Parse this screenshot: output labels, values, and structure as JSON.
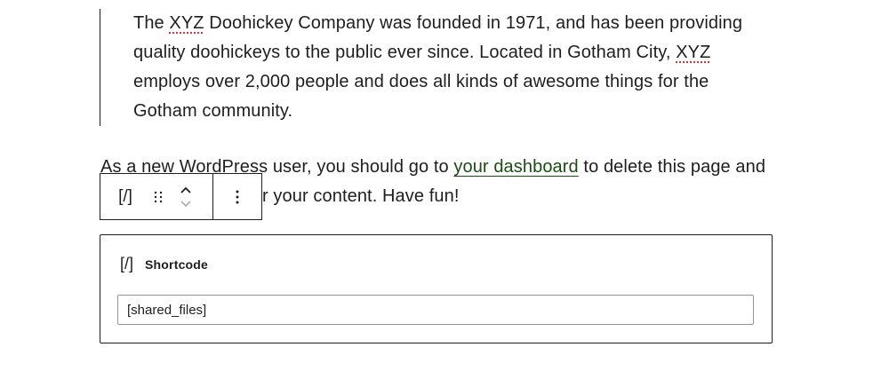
{
  "quote": {
    "part1": "The ",
    "xyz1": "XYZ",
    "part2": " Doohickey Company was founded in 1971, and has been providing quality doohickeys to the public ever since. Located in Gotham City, ",
    "xyz2": "XYZ",
    "part3": " employs over 2,000 people and does all kinds of awesome things for the Gotham community."
  },
  "paragraph": {
    "before_link": "As a new WordPress user, you should go to ",
    "link_text": "your dashboard",
    "after_link": " to delete this page and create new pages for your content. Have fun!"
  },
  "toolbar": {
    "block_type_icon": "[/]",
    "drag_handle_icon": "drag-handle-icon",
    "move_up_icon": "chevron-up-icon",
    "move_down_icon": "chevron-down-icon",
    "more_options_icon": "vertical-ellipsis-icon"
  },
  "shortcode_block": {
    "icon": "[/]",
    "label": "Shortcode",
    "value": "[shared_files]"
  },
  "colors": {
    "text": "#1e1e1e",
    "link": "#1a4d12",
    "spellcheck": "#d63638"
  }
}
